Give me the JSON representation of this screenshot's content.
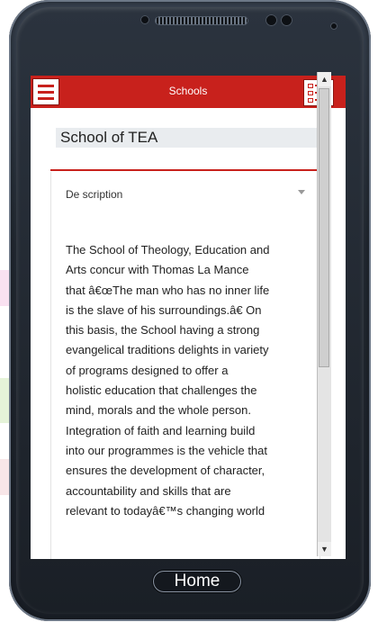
{
  "header": {
    "title": "Schools",
    "menu_icon": "hamburger-menu-icon",
    "list_icon": "list-view-icon"
  },
  "school": {
    "name": "School of TEA"
  },
  "description": {
    "heading": "De scription",
    "lines": [
      "The School of Theology, Education and",
      "Arts concur with Thomas La Mance",
      "that â€œThe man who has no inner life",
      "is the slave of his surroundings.â€ On",
      "this basis, the School  having a strong",
      "evangelical traditions  delights in variety",
      "of programs designed to offer a",
      "holistic education that  challenges the",
      "mind, morals and the whole person.",
      "Integration of faith and learning build",
      "into our programmes is the vehicle that",
      "ensures the development of character,",
      "accountability and skills that are",
      "relevant to todayâ€™s changing world"
    ]
  },
  "device": {
    "home_label": "Home"
  },
  "colors": {
    "accent": "#c8211c",
    "phone_body": "#242b34"
  }
}
